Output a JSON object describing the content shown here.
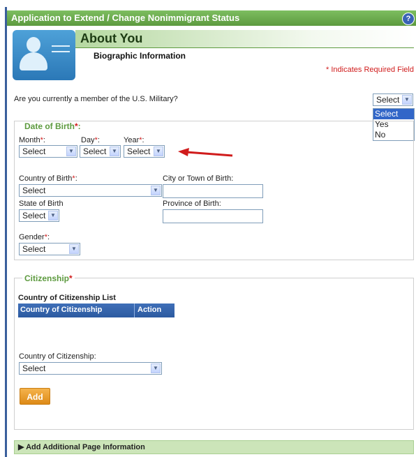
{
  "window": {
    "title": "Application to Extend / Change Nonimmigrant Status",
    "help_icon": "?"
  },
  "header": {
    "heading": "About You",
    "subheading": "Biographic Information",
    "required_note": "* Indicates Required Field"
  },
  "military": {
    "question": "Are you currently a member of the U.S. Military?",
    "selected": "Select",
    "options": [
      "Select",
      "Yes",
      "No"
    ],
    "highlighted": "Select"
  },
  "dob": {
    "legend": "Date of Birth",
    "month_label": "Month",
    "month_value": "Select",
    "day_label": "Day",
    "day_value": "Select",
    "year_label": "Year",
    "year_value": "Select",
    "star": "*",
    "colon": ":"
  },
  "birth": {
    "country_label": "Country of Birth",
    "country_value": "Select",
    "city_label": "City or Town of Birth:",
    "state_label": "State of Birth",
    "state_value": "Select",
    "province_label": "Province of Birth:",
    "gender_label": "Gender",
    "gender_value": "Select"
  },
  "citizenship": {
    "legend": "Citizenship",
    "list_title": "Country of Citizenship List",
    "columns": [
      "Country of Citizenship",
      "Action"
    ],
    "field_label": "Country of Citizenship:",
    "field_value": "Select",
    "add_label": "Add"
  },
  "footer": {
    "label": "Add Additional Page Information"
  },
  "colors": {
    "accent_green": "#5d9a3f",
    "required_red": "#d01c1c",
    "table_blue": "#2c5aa0",
    "add_orange": "#dd8a17"
  }
}
